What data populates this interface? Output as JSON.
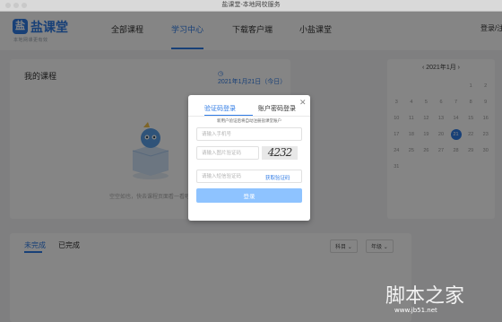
{
  "window": {
    "title": "盐课堂-本地网校服务"
  },
  "brand": {
    "name": "盐课堂",
    "logo_char": "盐",
    "slogan": "本地网课更有效"
  },
  "nav": {
    "items": [
      "全部课程",
      "学习中心",
      "下载客户端",
      "小盐课堂"
    ],
    "active_index": 1,
    "login_label": "登录/注册"
  },
  "courses": {
    "title": "我的课程",
    "date_label": "2021年1月21日（今日）",
    "empty_text": "空空如也，快去课程页面看一看吧～"
  },
  "calendar": {
    "month_label": "2021年1月",
    "prev_icon": "chevron-left-icon",
    "next_icon": "chevron-right-icon",
    "today": 21,
    "days": [
      "",
      "",
      "",
      "",
      "",
      "1",
      "2",
      "3",
      "4",
      "5",
      "6",
      "7",
      "8",
      "9",
      "10",
      "11",
      "12",
      "13",
      "14",
      "15",
      "16",
      "17",
      "18",
      "19",
      "20",
      "21",
      "22",
      "23",
      "24",
      "25",
      "26",
      "27",
      "28",
      "29",
      "30",
      "31"
    ]
  },
  "bottom": {
    "tabs": [
      "未完成",
      "已完成"
    ],
    "active_tab": 0,
    "filters": [
      "科目",
      "年级"
    ]
  },
  "modal": {
    "tabs": [
      "验证码登录",
      "账户密码登录"
    ],
    "active_tab": 0,
    "hint": "新用户验证后将自动注册盐课堂账户",
    "phone_placeholder": "请输入手机号",
    "captcha_placeholder": "请输入图片验证码",
    "captcha_text": "4232",
    "sms_placeholder": "请输入短信验证码",
    "sms_link": "获取验证码",
    "login_button": "登录"
  },
  "watermark": {
    "text": "脚本之家",
    "sub": "www.jb51.net"
  },
  "colors": {
    "accent": "#2f7be5",
    "button": "#8ec3ff"
  }
}
